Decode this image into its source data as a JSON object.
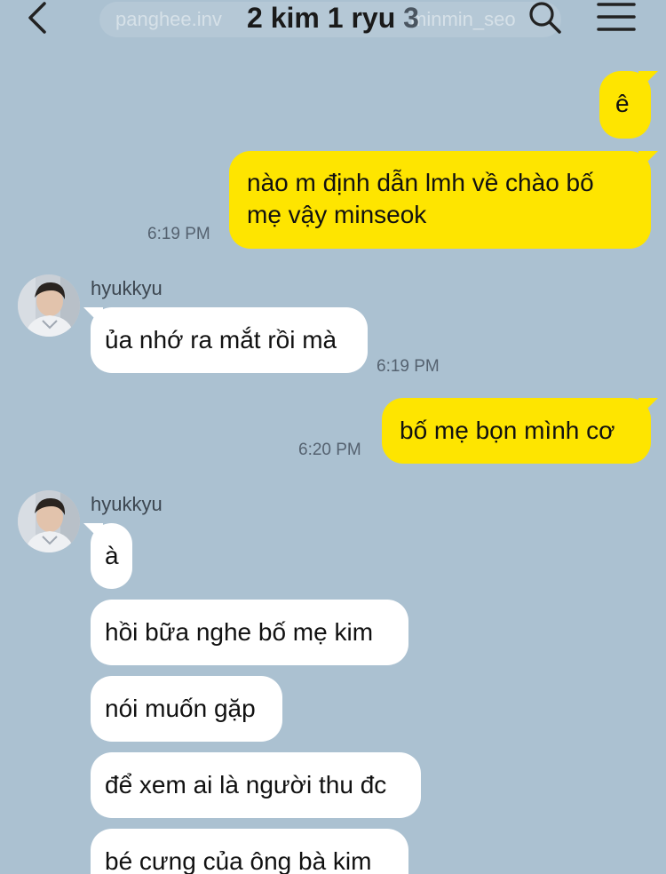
{
  "header": {
    "title": "2 kim 1 ryu",
    "member_count": "3",
    "watermark_left": "panghee.inv",
    "watermark_right": "minmin_seo"
  },
  "messages": [
    {
      "from": "me",
      "text": "ê"
    },
    {
      "from": "me",
      "text": "nào m định dẫn lmh về chào bố mẹ vậy minseok",
      "time": "6:19 PM"
    },
    {
      "from": "hyukkyu",
      "sender": "hyukkyu",
      "text": "ủa nhớ ra mắt rồi mà",
      "time": "6:19 PM"
    },
    {
      "from": "me",
      "text": "bố mẹ bọn mình cơ",
      "time": "6:20 PM"
    },
    {
      "from": "hyukkyu",
      "sender": "hyukkyu",
      "text": "à"
    },
    {
      "from": "hyukkyu",
      "text": "hồi bữa nghe bố mẹ kim"
    },
    {
      "from": "hyukkyu",
      "text": "nói muốn gặp"
    },
    {
      "from": "hyukkyu",
      "text": "để xem ai là người thu đc"
    },
    {
      "from": "hyukkyu",
      "text": "bé cưng của ông bà kim"
    }
  ],
  "colors": {
    "background": "#abc1d1",
    "my_bubble": "#fee500",
    "their_bubble": "#ffffff",
    "timestamp": "#556270"
  },
  "icons": {
    "back": "chevron-left-icon",
    "search": "search-icon",
    "menu": "hamburger-menu-icon"
  }
}
